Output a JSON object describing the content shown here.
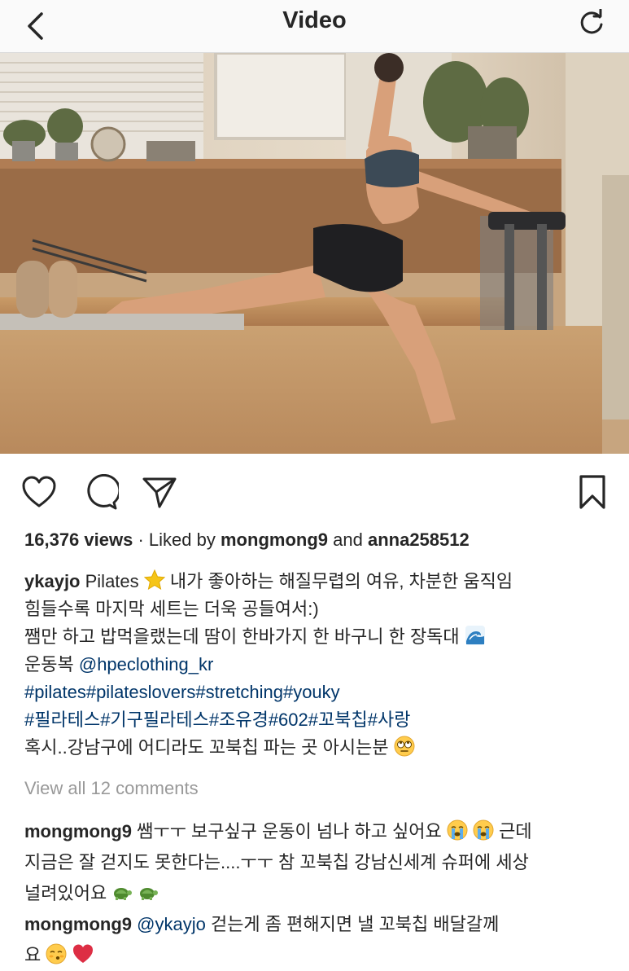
{
  "header": {
    "title": "Video",
    "back_icon": "chevron-left-icon",
    "refresh_icon": "refresh-icon"
  },
  "video": {
    "description_icon": "video-player"
  },
  "actions": {
    "like_icon": "heart-icon",
    "comment_icon": "comment-icon",
    "share_icon": "paper-plane-icon",
    "save_icon": "bookmark-icon"
  },
  "stats": {
    "views": "16,376 views",
    "separator": "·",
    "liked_by_prefix": "Liked by",
    "liked_user_1": "mongmong9",
    "and_text": "and",
    "liked_user_2": "anna258512"
  },
  "caption": {
    "username": "ykayjo",
    "line1_text": "Pilates",
    "line1_rest": "내가 좋아하는 해질무렵의 여유, 차분한 움직임",
    "line2": "힘들수록 마지막 세트는 더욱 공들여서:)",
    "line3": "쨈만 하고 밥먹을랬는데 땀이 한바가지 한 바구니 한 장독대",
    "line4_prefix": "운동복",
    "line4_mention": "@hpeclothing_kr",
    "line5": "#pilates#pilateslovers#stretching#youky",
    "line6": "#필라테스#기구필라테스#조유경#602#꼬북칩#사랑",
    "line7": "혹시..강남구에 어디라도 꼬북칩 파는 곳 아시는분"
  },
  "view_all_comments": "View all 12 comments",
  "comments": [
    {
      "username": "mongmong9",
      "line1": "쌤ㅜㅜ 보구싶구 운동이 넘나 하고 싶어요",
      "line1_end": "근데",
      "line2": "지금은 잘 걷지도 못한다는....ㅜㅜ 참 꼬북칩 강남신세계 슈퍼에 세상",
      "line3": "널려있어요"
    },
    {
      "username": "mongmong9",
      "mention": "@ykayjo",
      "line1": "걷는게 좀 편해지면 낼 꼬북칩 배달갈께",
      "line2": "요"
    }
  ],
  "colors": {
    "text": "#262626",
    "link": "#003569",
    "muted": "#999999",
    "header_bg": "#fafafa"
  }
}
